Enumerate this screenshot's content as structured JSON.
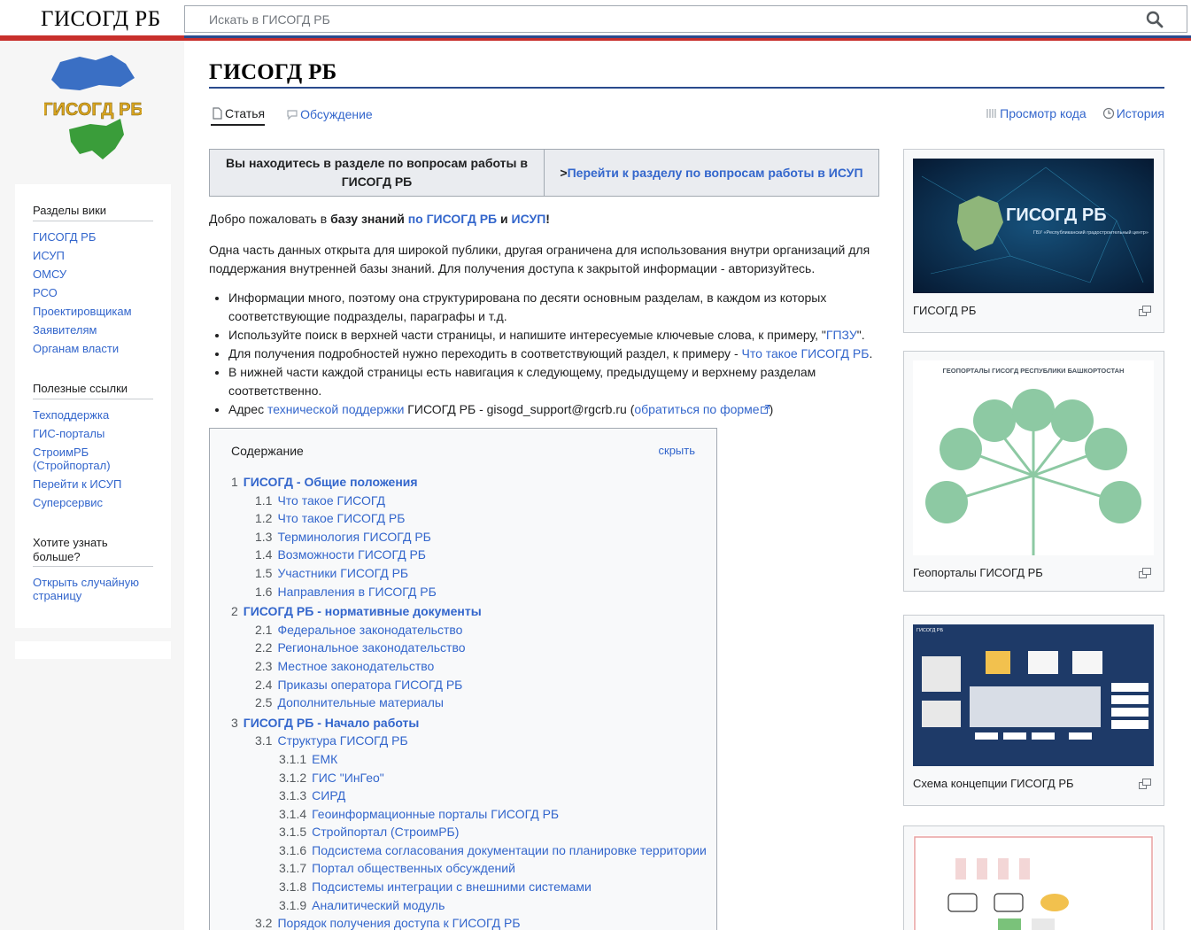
{
  "header": {
    "site_title": "ГИСОГД РБ",
    "search_placeholder": "Искать в ГИСОГД РБ"
  },
  "colors": {
    "brand_red": "#c8302c",
    "brand_blue": "#2a4b8d",
    "link": "#3366cc"
  },
  "logo": {
    "text": "ГИСОГД РБ"
  },
  "sidebar": {
    "sections": [
      {
        "heading": "Разделы вики",
        "items": [
          "ГИСОГД РБ",
          "ИСУП",
          "ОМСУ",
          "РСО",
          "Проектировщикам",
          "Заявителям",
          "Органам власти"
        ]
      },
      {
        "heading": "Полезные ссылки",
        "items": [
          "Техподдержка",
          "ГИС-порталы",
          "СтроимРБ (Стройпортал)",
          "Перейти к ИСУП",
          "Суперсервис"
        ]
      },
      {
        "heading": "Хотите узнать больше?",
        "items": [
          "Открыть случайную страницу"
        ]
      }
    ]
  },
  "page": {
    "title": "ГИСОГД РБ",
    "tabs": {
      "article": "Статья",
      "discussion": "Обсуждение",
      "view_source": "Просмотр кода",
      "history": "История"
    },
    "notice": {
      "left": "Вы находитесь в разделе по вопросам работы в ГИСОГД РБ",
      "right_prefix": ">",
      "right": "Перейти к разделу по вопросам работы в ИСУП"
    },
    "welcome": {
      "p1": "Добро пожаловать в ",
      "bold1": "базу знаний",
      "link1": "по ГИСОГД РБ",
      "and": " и ",
      "link2": "ИСУП",
      "end": "!"
    },
    "intro": "Одна часть данных открыта для широкой публики, другая ограничена для использования внутри организаций для поддержания внутренней базы знаний. Для получения доступа к закрытой информации - авторизуйтесь.",
    "bullets": {
      "b1": "Информации много, поэтому она структурирована по десяти основным разделам, в каждом из которых соответствующие подразделы, параграфы и т.д.",
      "b2_pre": "Используйте поиск в верхней части страницы, и напишите интересуемые ключевые слова, к примеру, \"",
      "b2_link": "ГПЗУ",
      "b2_post": "\".",
      "b3_pre": "Для получения подробностей нужно переходить в соответствующий раздел, к примеру - ",
      "b3_link": "Что такое ГИСОГД РБ",
      "b3_post": ".",
      "b4": "В нижней части каждой страницы есть навигация к следующему, предыдущему и верхнему разделам соответственно.",
      "b5_pre": "Адрес ",
      "b5_link": "технической поддержки",
      "b5_mid": " ГИСОГД РБ - gisogd_support@rgcrb.ru (",
      "b5_link2": "обратиться по форме",
      "b5_post": ")"
    },
    "toc": {
      "title": "Содержание",
      "hide": "скрыть",
      "items": [
        {
          "level": 1,
          "num": "1",
          "text": "ГИСОГД - Общие положения"
        },
        {
          "level": 2,
          "num": "1.1",
          "text": "Что такое ГИСОГД"
        },
        {
          "level": 2,
          "num": "1.2",
          "text": "Что такое ГИСОГД РБ"
        },
        {
          "level": 2,
          "num": "1.3",
          "text": "Терминология ГИСОГД РБ"
        },
        {
          "level": 2,
          "num": "1.4",
          "text": "Возможности ГИСОГД РБ"
        },
        {
          "level": 2,
          "num": "1.5",
          "text": "Участники ГИСОГД РБ"
        },
        {
          "level": 2,
          "num": "1.6",
          "text": "Направления в ГИСОГД РБ"
        },
        {
          "level": 1,
          "num": "2",
          "text": "ГИСОГД РБ - нормативные документы"
        },
        {
          "level": 2,
          "num": "2.1",
          "text": "Федеральное законодательство"
        },
        {
          "level": 2,
          "num": "2.2",
          "text": "Региональное законодательство"
        },
        {
          "level": 2,
          "num": "2.3",
          "text": "Местное законодательство"
        },
        {
          "level": 2,
          "num": "2.4",
          "text": "Приказы оператора ГИСОГД РБ"
        },
        {
          "level": 2,
          "num": "2.5",
          "text": "Дополнительные материалы"
        },
        {
          "level": 1,
          "num": "3",
          "text": "ГИСОГД РБ - Начало работы"
        },
        {
          "level": 2,
          "num": "3.1",
          "text": "Структура ГИСОГД РБ"
        },
        {
          "level": 3,
          "num": "3.1.1",
          "text": "ЕМК"
        },
        {
          "level": 3,
          "num": "3.1.2",
          "text": "ГИС \"ИнГео\""
        },
        {
          "level": 3,
          "num": "3.1.3",
          "text": "СИРД"
        },
        {
          "level": 3,
          "num": "3.1.4",
          "text": "Геоинформационные порталы ГИСОГД РБ"
        },
        {
          "level": 3,
          "num": "3.1.5",
          "text": "Стройпортал (СтроимРБ)"
        },
        {
          "level": 3,
          "num": "3.1.6",
          "text": "Подсистема согласования документации по планировке территории"
        },
        {
          "level": 3,
          "num": "3.1.7",
          "text": "Портал общественных обсуждений"
        },
        {
          "level": 3,
          "num": "3.1.8",
          "text": "Подсистемы интеграции с внешними системами"
        },
        {
          "level": 3,
          "num": "3.1.9",
          "text": "Аналитический модуль"
        },
        {
          "level": 2,
          "num": "3.2",
          "text": "Порядок получения доступа к ГИСОГД РБ"
        }
      ]
    },
    "thumbs": [
      {
        "caption": "ГИСОГД РБ",
        "img_title": "ГИСОГД РБ",
        "img_sub": "ГБУ «Республиканский градостроительный центр»"
      },
      {
        "caption": "Геопорталы ГИСОГД РБ",
        "img_title": "ГЕОПОРТАЛЫ ГИСОГД РЕСПУБЛИКИ БАШКОРТОСТАН"
      },
      {
        "caption": "Схема концепции ГИСОГД РБ",
        "img_title": "ГИСОГД РБ"
      },
      {
        "caption": ""
      }
    ]
  }
}
